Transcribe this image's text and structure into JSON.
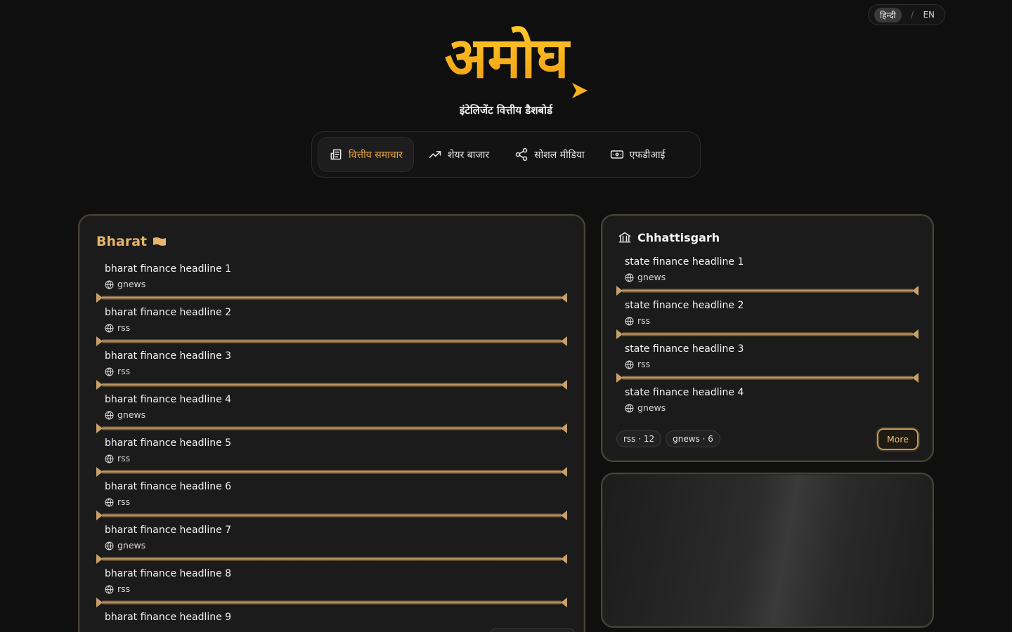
{
  "lang": {
    "active": "हिन्दी",
    "separator": "/",
    "other": "EN"
  },
  "brand": {
    "logo_text": "अमोघ",
    "tagline": "इंटेलिजेंट वित्तीय डैशबोर्ड"
  },
  "nav": [
    {
      "label": "वित्तीय समाचार",
      "icon": "newspaper-icon",
      "active": true
    },
    {
      "label": "शेयर बाजार",
      "icon": "trending-up-icon",
      "active": false
    },
    {
      "label": "सोशल मीडिया",
      "icon": "share-icon",
      "active": false
    },
    {
      "label": "एफडीआई",
      "icon": "banknote-icon",
      "active": false
    }
  ],
  "bharat": {
    "title": "Bharat",
    "items": [
      {
        "headline": "bharat finance headline 1",
        "source": "gnews"
      },
      {
        "headline": "bharat finance headline 2",
        "source": "rss"
      },
      {
        "headline": "bharat finance headline 3",
        "source": "rss"
      },
      {
        "headline": "bharat finance headline 4",
        "source": "gnews"
      },
      {
        "headline": "bharat finance headline 5",
        "source": "rss"
      },
      {
        "headline": "bharat finance headline 6",
        "source": "rss"
      },
      {
        "headline": "bharat finance headline 7",
        "source": "gnews"
      },
      {
        "headline": "bharat finance headline 8",
        "source": "rss"
      },
      {
        "headline": "bharat finance headline 9",
        "source": ""
      }
    ]
  },
  "state": {
    "title": "Chhattisgarh",
    "items": [
      {
        "headline": "state finance headline 1",
        "source": "gnews"
      },
      {
        "headline": "state finance headline 2",
        "source": "rss"
      },
      {
        "headline": "state finance headline 3",
        "source": "rss"
      },
      {
        "headline": "state finance headline 4",
        "source": "gnews"
      }
    ],
    "chips": [
      "rss · 12",
      "gnews · 6"
    ],
    "more_label": "More"
  },
  "colors": {
    "accent": "#f0a83a",
    "gold": "#c7a06a",
    "background": "#0f0f0f"
  }
}
